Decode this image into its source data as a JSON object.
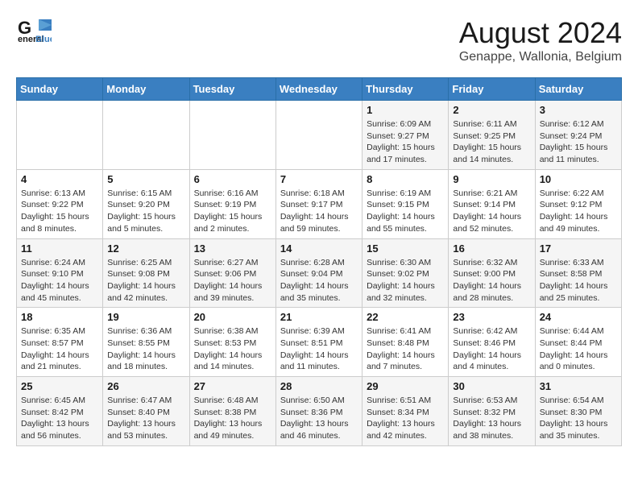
{
  "header": {
    "logo_general": "General",
    "logo_blue": "Blue",
    "month_year": "August 2024",
    "location": "Genappe, Wallonia, Belgium"
  },
  "calendar": {
    "days_of_week": [
      "Sunday",
      "Monday",
      "Tuesday",
      "Wednesday",
      "Thursday",
      "Friday",
      "Saturday"
    ],
    "weeks": [
      [
        {
          "day": "",
          "info": ""
        },
        {
          "day": "",
          "info": ""
        },
        {
          "day": "",
          "info": ""
        },
        {
          "day": "",
          "info": ""
        },
        {
          "day": "1",
          "info": "Sunrise: 6:09 AM\nSunset: 9:27 PM\nDaylight: 15 hours and 17 minutes."
        },
        {
          "day": "2",
          "info": "Sunrise: 6:11 AM\nSunset: 9:25 PM\nDaylight: 15 hours and 14 minutes."
        },
        {
          "day": "3",
          "info": "Sunrise: 6:12 AM\nSunset: 9:24 PM\nDaylight: 15 hours and 11 minutes."
        }
      ],
      [
        {
          "day": "4",
          "info": "Sunrise: 6:13 AM\nSunset: 9:22 PM\nDaylight: 15 hours and 8 minutes."
        },
        {
          "day": "5",
          "info": "Sunrise: 6:15 AM\nSunset: 9:20 PM\nDaylight: 15 hours and 5 minutes."
        },
        {
          "day": "6",
          "info": "Sunrise: 6:16 AM\nSunset: 9:19 PM\nDaylight: 15 hours and 2 minutes."
        },
        {
          "day": "7",
          "info": "Sunrise: 6:18 AM\nSunset: 9:17 PM\nDaylight: 14 hours and 59 minutes."
        },
        {
          "day": "8",
          "info": "Sunrise: 6:19 AM\nSunset: 9:15 PM\nDaylight: 14 hours and 55 minutes."
        },
        {
          "day": "9",
          "info": "Sunrise: 6:21 AM\nSunset: 9:14 PM\nDaylight: 14 hours and 52 minutes."
        },
        {
          "day": "10",
          "info": "Sunrise: 6:22 AM\nSunset: 9:12 PM\nDaylight: 14 hours and 49 minutes."
        }
      ],
      [
        {
          "day": "11",
          "info": "Sunrise: 6:24 AM\nSunset: 9:10 PM\nDaylight: 14 hours and 45 minutes."
        },
        {
          "day": "12",
          "info": "Sunrise: 6:25 AM\nSunset: 9:08 PM\nDaylight: 14 hours and 42 minutes."
        },
        {
          "day": "13",
          "info": "Sunrise: 6:27 AM\nSunset: 9:06 PM\nDaylight: 14 hours and 39 minutes."
        },
        {
          "day": "14",
          "info": "Sunrise: 6:28 AM\nSunset: 9:04 PM\nDaylight: 14 hours and 35 minutes."
        },
        {
          "day": "15",
          "info": "Sunrise: 6:30 AM\nSunset: 9:02 PM\nDaylight: 14 hours and 32 minutes."
        },
        {
          "day": "16",
          "info": "Sunrise: 6:32 AM\nSunset: 9:00 PM\nDaylight: 14 hours and 28 minutes."
        },
        {
          "day": "17",
          "info": "Sunrise: 6:33 AM\nSunset: 8:58 PM\nDaylight: 14 hours and 25 minutes."
        }
      ],
      [
        {
          "day": "18",
          "info": "Sunrise: 6:35 AM\nSunset: 8:57 PM\nDaylight: 14 hours and 21 minutes."
        },
        {
          "day": "19",
          "info": "Sunrise: 6:36 AM\nSunset: 8:55 PM\nDaylight: 14 hours and 18 minutes."
        },
        {
          "day": "20",
          "info": "Sunrise: 6:38 AM\nSunset: 8:53 PM\nDaylight: 14 hours and 14 minutes."
        },
        {
          "day": "21",
          "info": "Sunrise: 6:39 AM\nSunset: 8:51 PM\nDaylight: 14 hours and 11 minutes."
        },
        {
          "day": "22",
          "info": "Sunrise: 6:41 AM\nSunset: 8:48 PM\nDaylight: 14 hours and 7 minutes."
        },
        {
          "day": "23",
          "info": "Sunrise: 6:42 AM\nSunset: 8:46 PM\nDaylight: 14 hours and 4 minutes."
        },
        {
          "day": "24",
          "info": "Sunrise: 6:44 AM\nSunset: 8:44 PM\nDaylight: 14 hours and 0 minutes."
        }
      ],
      [
        {
          "day": "25",
          "info": "Sunrise: 6:45 AM\nSunset: 8:42 PM\nDaylight: 13 hours and 56 minutes."
        },
        {
          "day": "26",
          "info": "Sunrise: 6:47 AM\nSunset: 8:40 PM\nDaylight: 13 hours and 53 minutes."
        },
        {
          "day": "27",
          "info": "Sunrise: 6:48 AM\nSunset: 8:38 PM\nDaylight: 13 hours and 49 minutes."
        },
        {
          "day": "28",
          "info": "Sunrise: 6:50 AM\nSunset: 8:36 PM\nDaylight: 13 hours and 46 minutes."
        },
        {
          "day": "29",
          "info": "Sunrise: 6:51 AM\nSunset: 8:34 PM\nDaylight: 13 hours and 42 minutes."
        },
        {
          "day": "30",
          "info": "Sunrise: 6:53 AM\nSunset: 8:32 PM\nDaylight: 13 hours and 38 minutes."
        },
        {
          "day": "31",
          "info": "Sunrise: 6:54 AM\nSunset: 8:30 PM\nDaylight: 13 hours and 35 minutes."
        }
      ]
    ]
  }
}
